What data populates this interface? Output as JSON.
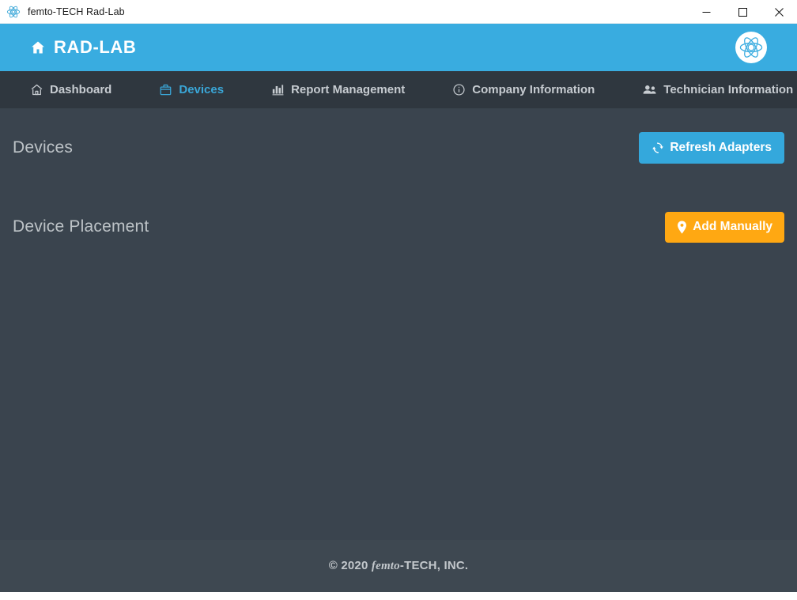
{
  "window": {
    "title": "femto-TECH Rad-Lab",
    "app_icon": "atom-icon",
    "controls": {
      "minimize": "minimize-icon",
      "maximize": "maximize-icon",
      "close": "close-icon"
    }
  },
  "header": {
    "home_icon": "home-icon",
    "brand": "RAD-LAB",
    "logo_icon": "atom-logo-icon",
    "background_color": "#39ace0"
  },
  "nav": {
    "background_color": "#2f373f",
    "active_color": "#3aa7d8",
    "items": [
      {
        "label": "Dashboard",
        "icon": "home-icon",
        "active": false
      },
      {
        "label": "Devices",
        "icon": "briefcase-icon",
        "active": true
      },
      {
        "label": "Report Management",
        "icon": "bar-chart-icon",
        "active": false
      },
      {
        "label": "Company Information",
        "icon": "info-circle-icon",
        "active": false
      },
      {
        "label": "Technician Information",
        "icon": "users-icon",
        "active": false
      }
    ]
  },
  "main": {
    "background_color": "#3a444e",
    "sections": [
      {
        "title": "Devices",
        "button": {
          "label": "Refresh Adapters",
          "icon": "refresh-icon",
          "color": "#34a8dc"
        }
      },
      {
        "title": "Device Placement",
        "button": {
          "label": "Add Manually",
          "icon": "map-pin-icon",
          "color": "#ffa812"
        }
      }
    ]
  },
  "footer": {
    "copyright_prefix": "© 2020 ",
    "company_italic": "femto",
    "company_rest": "-TECH, INC.",
    "background_color": "#3e4851"
  }
}
